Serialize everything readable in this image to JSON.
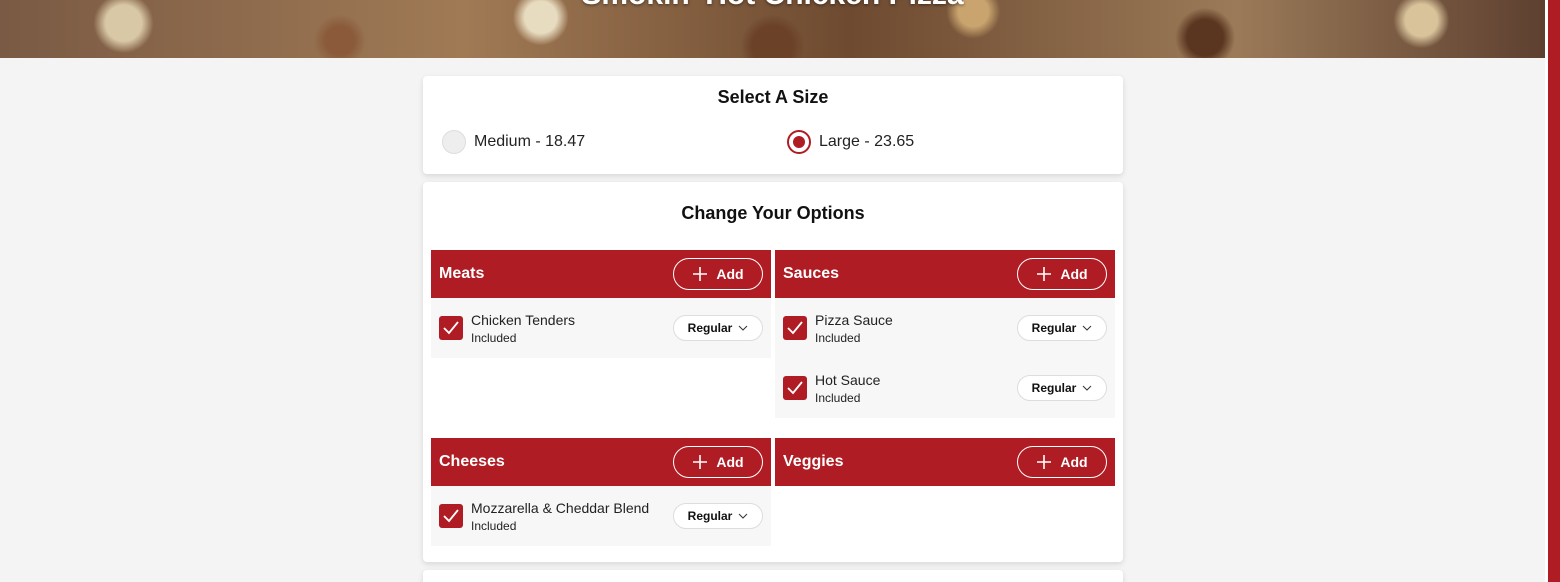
{
  "hero": {
    "title": "Smokin' Hot Chicken Pizza"
  },
  "size_section": {
    "title": "Select A Size",
    "options": [
      {
        "label": "Medium - 18.47",
        "selected": false
      },
      {
        "label": "Large - 23.65",
        "selected": true
      }
    ]
  },
  "options_section": {
    "title": "Change Your Options",
    "add_label": "Add",
    "groups": [
      {
        "name": "Meats",
        "items": [
          {
            "name": "Chicken Tenders",
            "status": "Included",
            "portion": "Regular"
          }
        ]
      },
      {
        "name": "Sauces",
        "items": [
          {
            "name": "Pizza Sauce",
            "status": "Included",
            "portion": "Regular"
          },
          {
            "name": "Hot Sauce",
            "status": "Included",
            "portion": "Regular"
          }
        ]
      },
      {
        "name": "Cheeses",
        "items": [
          {
            "name": "Mozzarella & Cheddar Blend",
            "status": "Included",
            "portion": "Regular"
          }
        ]
      },
      {
        "name": "Veggies",
        "items": []
      }
    ]
  },
  "colors": {
    "accent": "#b01c24",
    "item_bg": "#f7f7f7"
  },
  "icons": {
    "add": "plus-icon",
    "checked": "checkmark-icon",
    "dropdown": "chevron-down-icon"
  }
}
